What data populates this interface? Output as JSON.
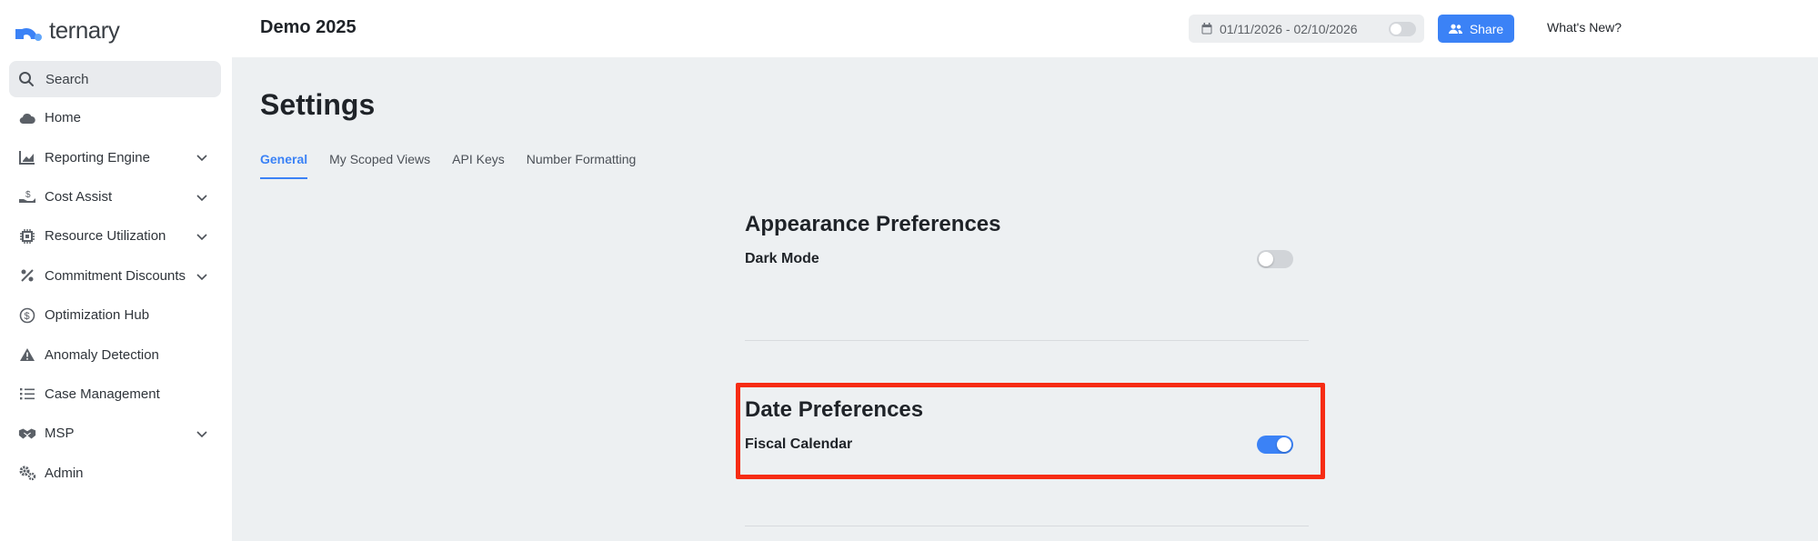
{
  "app": {
    "logo_text": "ternary"
  },
  "sidebar": {
    "search_label": "Search",
    "items": [
      {
        "label": "Home",
        "icon": "cloud-icon",
        "expandable": false
      },
      {
        "label": "Reporting Engine",
        "icon": "chart-icon",
        "expandable": true
      },
      {
        "label": "Cost Assist",
        "icon": "hand-coin-icon",
        "expandable": true
      },
      {
        "label": "Resource Utilization",
        "icon": "chip-icon",
        "expandable": true
      },
      {
        "label": "Commitment Discounts",
        "icon": "percent-icon",
        "expandable": true
      },
      {
        "label": "Optimization Hub",
        "icon": "dollar-circle-icon",
        "expandable": false
      },
      {
        "label": "Anomaly Detection",
        "icon": "warning-icon",
        "expandable": false
      },
      {
        "label": "Case Management",
        "icon": "list-icon",
        "expandable": false
      },
      {
        "label": "MSP",
        "icon": "handshake-icon",
        "expandable": true
      },
      {
        "label": "Admin",
        "icon": "gears-icon",
        "expandable": false
      }
    ]
  },
  "header": {
    "context_title": "Demo 2025",
    "date_range": "01/11/2026 - 02/10/2026",
    "share_label": "Share",
    "whats_new_label": "What's New?"
  },
  "main": {
    "title": "Settings",
    "tabs": [
      {
        "label": "General",
        "active": true
      },
      {
        "label": "My Scoped Views",
        "active": false
      },
      {
        "label": "API Keys",
        "active": false
      },
      {
        "label": "Number Formatting",
        "active": false
      }
    ],
    "sections": [
      {
        "title": "Appearance Preferences",
        "preference": {
          "label": "Dark Mode",
          "enabled": false
        }
      },
      {
        "title": "Date Preferences",
        "preference": {
          "label": "Fiscal Calendar",
          "enabled": true
        }
      }
    ]
  },
  "colors": {
    "accent": "#3b82f6",
    "highlight": "#f62c14",
    "main_background": "#edf0f2"
  }
}
